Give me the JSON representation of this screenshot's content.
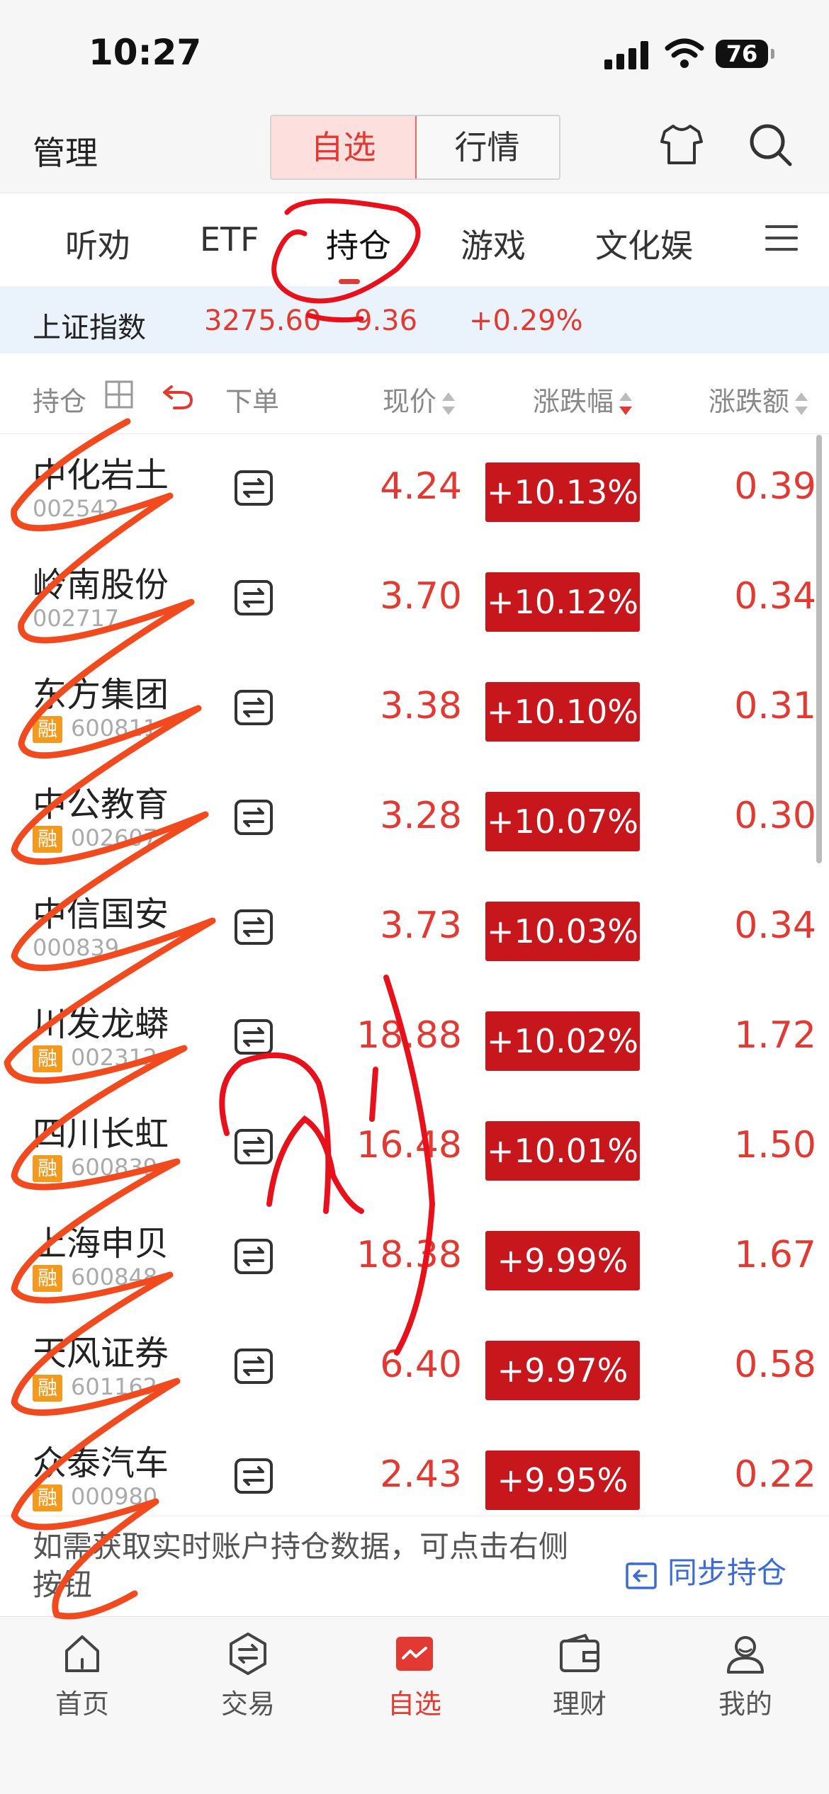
{
  "status": {
    "time": "10:27",
    "battery": "76"
  },
  "header": {
    "manage": "管理",
    "seg_active": "自选",
    "seg_other": "行情"
  },
  "tabs": [
    "听劝",
    "ETF",
    "持仓",
    "游戏",
    "文化娱"
  ],
  "index": {
    "name": "上证指数",
    "value": "3275.60",
    "change": "9.36",
    "pct": "+0.29%"
  },
  "columns": {
    "holdings": "持仓",
    "order": "下单",
    "price": "现价",
    "pct": "涨跌幅",
    "amount": "涨跌额"
  },
  "stocks": [
    {
      "name": "中化岩土",
      "code": "002542",
      "margin": false,
      "price": "4.24",
      "pct": "+10.13%",
      "amount": "0.39"
    },
    {
      "name": "岭南股份",
      "code": "002717",
      "margin": false,
      "price": "3.70",
      "pct": "+10.12%",
      "amount": "0.34"
    },
    {
      "name": "东方集团",
      "code": "600811",
      "margin": true,
      "price": "3.38",
      "pct": "+10.10%",
      "amount": "0.31"
    },
    {
      "name": "中公教育",
      "code": "002607",
      "margin": true,
      "price": "3.28",
      "pct": "+10.07%",
      "amount": "0.30"
    },
    {
      "name": "中信国安",
      "code": "000839",
      "margin": false,
      "price": "3.73",
      "pct": "+10.03%",
      "amount": "0.34"
    },
    {
      "name": "川发龙蟒",
      "code": "002312",
      "margin": true,
      "price": "18.88",
      "pct": "+10.02%",
      "amount": "1.72"
    },
    {
      "name": "四川长虹",
      "code": "600839",
      "margin": true,
      "price": "16.48",
      "pct": "+10.01%",
      "amount": "1.50"
    },
    {
      "name": "上海申贝",
      "code": "600848",
      "margin": true,
      "price": "18.38",
      "pct": "+9.99%",
      "amount": "1.67"
    },
    {
      "name": "天风证券",
      "code": "601162",
      "margin": true,
      "price": "6.40",
      "pct": "+9.97%",
      "amount": "0.58"
    },
    {
      "name": "众泰汽车",
      "code": "000980",
      "margin": true,
      "price": "2.43",
      "pct": "+9.95%",
      "amount": "0.22"
    }
  ],
  "notice": {
    "text": "如需获取实时账户持仓数据，可点击右侧按钮",
    "sync": "同步持仓"
  },
  "tabbar": [
    {
      "label": "首页",
      "icon": "home-icon"
    },
    {
      "label": "交易",
      "icon": "trade-icon"
    },
    {
      "label": "自选",
      "icon": "watchlist-icon"
    },
    {
      "label": "理财",
      "icon": "wallet-icon"
    },
    {
      "label": "我的",
      "icon": "profile-icon"
    }
  ],
  "colors": {
    "up": "#e23a32",
    "up_badge": "#c8161d",
    "link": "#3c6bd6",
    "margin_badge": "#f39a1e"
  }
}
